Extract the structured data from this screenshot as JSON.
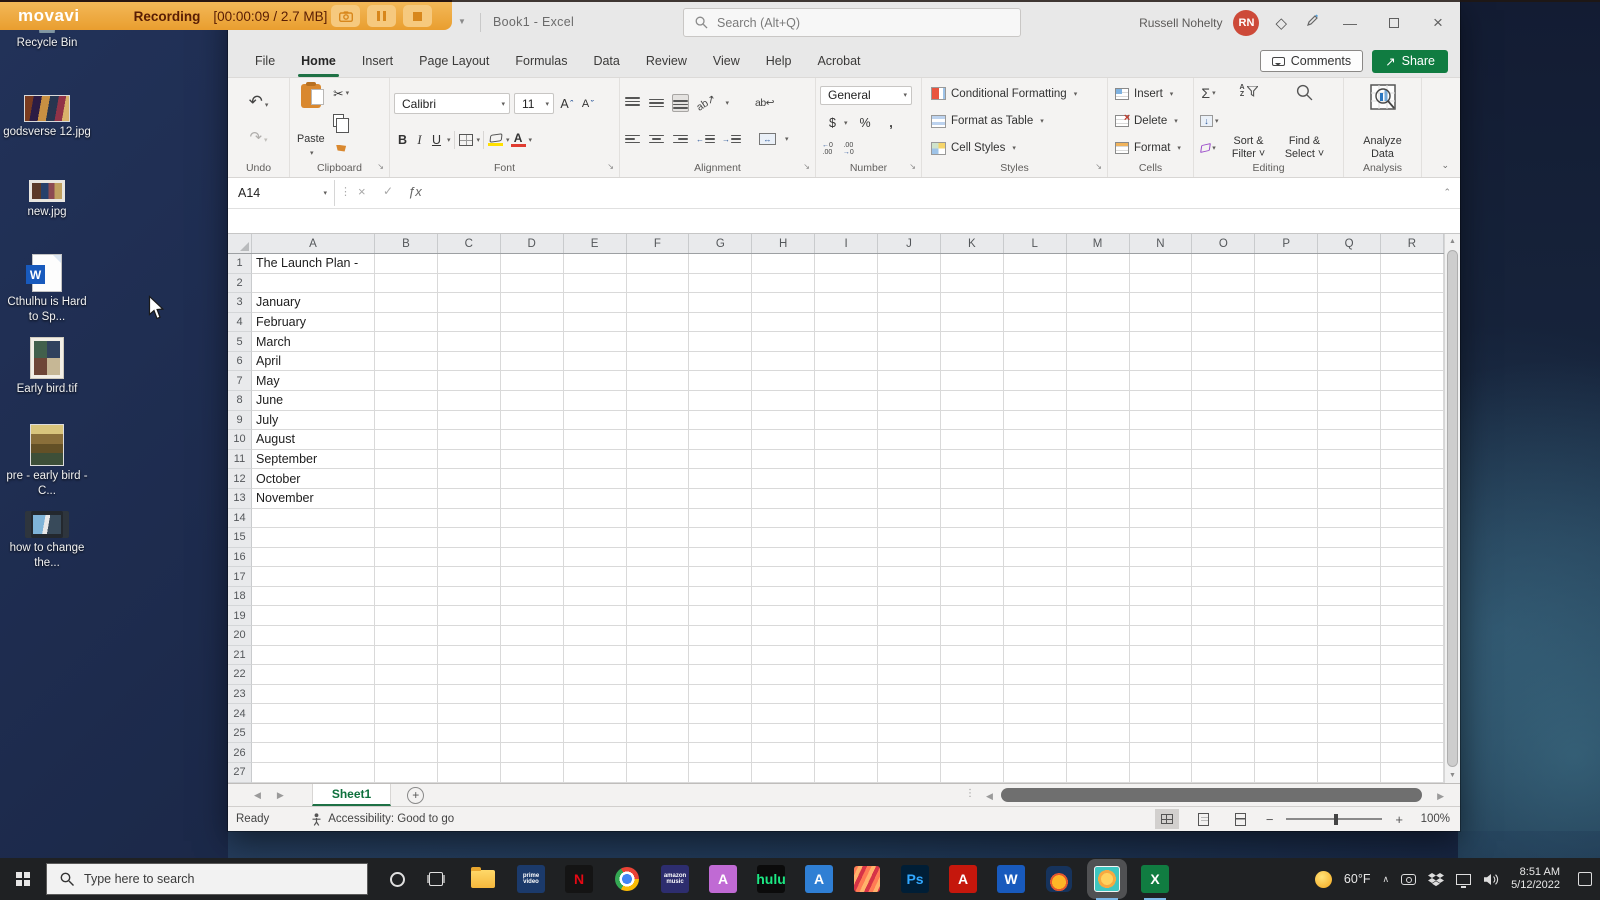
{
  "colors": {
    "excel_green": "#107c41",
    "movavi_orange": "#eda43d",
    "avatar_red": "#cd4a39",
    "taskbar_dark": "#1f2123"
  },
  "movavi_bar": {
    "logo": "movavi",
    "status_label": "Recording",
    "counter": "[00:00:09 / 2.7 MB]"
  },
  "excel": {
    "title": "Book1  -  Excel",
    "search_placeholder": "Search (Alt+Q)",
    "user_name": "Russell Nohelty",
    "user_initials": "RN",
    "tabs": [
      {
        "label": "File",
        "active": false
      },
      {
        "label": "Home",
        "active": true
      },
      {
        "label": "Insert",
        "active": false
      },
      {
        "label": "Page Layout",
        "active": false
      },
      {
        "label": "Formulas",
        "active": false
      },
      {
        "label": "Data",
        "active": false
      },
      {
        "label": "Review",
        "active": false
      },
      {
        "label": "View",
        "active": false
      },
      {
        "label": "Help",
        "active": false
      },
      {
        "label": "Acrobat",
        "active": false
      }
    ],
    "comments_label": "Comments",
    "share_label": "Share",
    "ribbon": {
      "group_labels": {
        "undo": "Undo",
        "clipboard": "Clipboard",
        "font": "Font",
        "alignment": "Alignment",
        "number": "Number",
        "styles": "Styles",
        "cells": "Cells",
        "editing": "Editing",
        "analysis": "Analysis"
      },
      "paste_label": "Paste",
      "font_name": "Calibri",
      "font_size": "11",
      "bold": "B",
      "italic": "I",
      "underline": "U",
      "number_format": "General",
      "conditional_formatting": "Conditional Formatting",
      "format_as_table": "Format as Table",
      "cell_styles": "Cell Styles",
      "insert": "Insert",
      "delete": "Delete",
      "format": "Format",
      "sort_filter": "Sort & Filter ˅",
      "find_select": "Find & Select ˅",
      "analyze_data": "Analyze Data"
    },
    "formula_bar": {
      "name_box": "A14",
      "fx": "ƒx",
      "value": ""
    },
    "sheet": {
      "columns": [
        "A",
        "B",
        "C",
        "D",
        "E",
        "F",
        "G",
        "H",
        "I",
        "J",
        "K",
        "L",
        "M",
        "N",
        "O",
        "P",
        "Q",
        "R"
      ],
      "row_count": 27,
      "cells": {
        "A1": "The Launch Plan -",
        "A3": "January",
        "A4": "February",
        "A5": "March",
        "A6": "April",
        "A7": "May",
        "A8": "June",
        "A9": "July",
        "A10": "August",
        "A11": "September",
        "A12": "October",
        "A13": "November"
      },
      "tab_name": "Sheet1"
    },
    "status_bar": {
      "mode": "Ready",
      "accessibility": "Accessibility: Good to go",
      "zoom_level": "100%"
    }
  },
  "desktop": {
    "icons": [
      {
        "label": "Recycle Bin",
        "kind": "bin"
      },
      {
        "label": "godsverse 12.jpg",
        "kind": "image"
      },
      {
        "label": "new.jpg",
        "kind": "image-small"
      },
      {
        "label": "Cthulhu is Hard to Sp...",
        "kind": "word"
      },
      {
        "label": "Early bird.tif",
        "kind": "tif"
      },
      {
        "label": "pre - early bird - C...",
        "kind": "image-tall"
      },
      {
        "label": "how to change the...",
        "kind": "video"
      }
    ]
  },
  "taskbar": {
    "search_placeholder": "Type here to search",
    "apps": [
      {
        "name": "file-explorer",
        "kind": "folder"
      },
      {
        "name": "prime-video",
        "text": "prime video",
        "bg": "#1b3a6b",
        "fg": "#ffffff"
      },
      {
        "name": "netflix",
        "text": "N",
        "bg": "#141414",
        "fg": "#e50914"
      },
      {
        "name": "chrome",
        "kind": "chrome"
      },
      {
        "name": "amazon-music",
        "text": "amazon music",
        "bg": "#2d2d6e",
        "fg": "#ffffff"
      },
      {
        "name": "affinity-publisher",
        "text": "A",
        "bg": "#c06ad4",
        "fg": "#ffffff"
      },
      {
        "name": "hulu",
        "text": "hulu",
        "bg": "#0b0b0b",
        "fg": "#1ce783"
      },
      {
        "name": "affinity-designer",
        "text": "A",
        "bg": "#2f7fd4",
        "fg": "#ffffff"
      },
      {
        "name": "affinity-photo",
        "kind": "stripes"
      },
      {
        "name": "photoshop",
        "text": "Ps",
        "bg": "#001e36",
        "fg": "#31a8ff"
      },
      {
        "name": "acrobat",
        "text": "A",
        "bg": "#c5170c",
        "fg": "#ffffff"
      },
      {
        "name": "word",
        "text": "W",
        "bg": "#185abd",
        "fg": "#ffffff"
      },
      {
        "name": "mail-orb",
        "kind": "orb"
      },
      {
        "name": "movavi-recorder",
        "kind": "recorder",
        "active": true
      },
      {
        "name": "excel",
        "text": "X",
        "bg": "#107c41",
        "fg": "#ffffff",
        "running": true
      }
    ],
    "tray": {
      "temperature": "60°F",
      "time": "8:51 AM",
      "date": "5/12/2022"
    }
  }
}
